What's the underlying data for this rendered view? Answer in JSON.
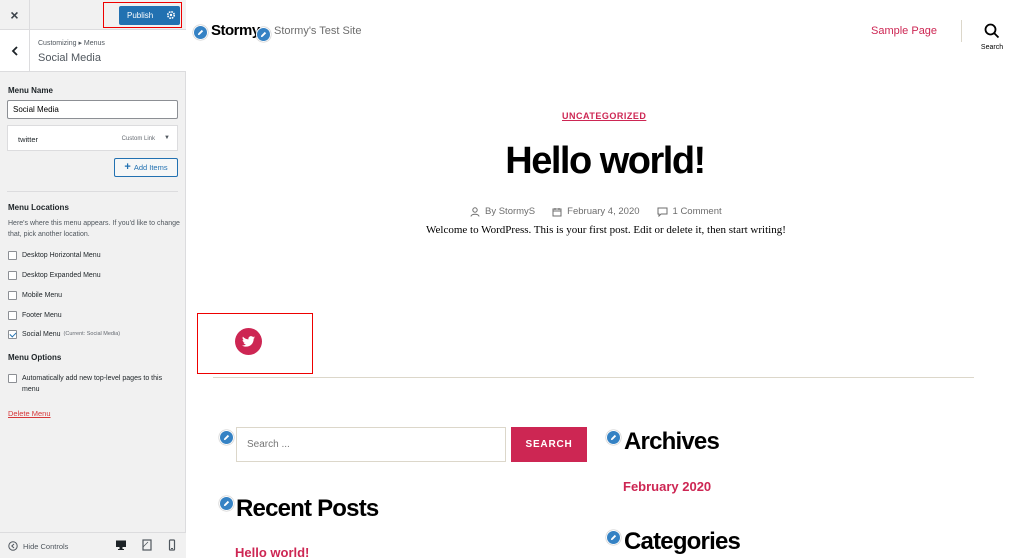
{
  "customizer": {
    "close_label": "×",
    "publish_label": "Publish",
    "breadcrumb": "Customizing ▸ Menus",
    "section_title": "Social Media",
    "menu_name_label": "Menu Name",
    "menu_name_value": "Social Media",
    "menu_item": {
      "title": "twitter",
      "type": "Custom Link",
      "toggle": "▼"
    },
    "add_items_label": "Add Items",
    "menu_locations_title": "Menu Locations",
    "menu_locations_desc": "Here's where this menu appears. If you'd like to change that, pick another location.",
    "locations": [
      {
        "label": "Desktop Horizontal Menu",
        "note": "",
        "checked": false
      },
      {
        "label": "Desktop Expanded Menu",
        "note": "",
        "checked": false
      },
      {
        "label": "Mobile Menu",
        "note": "",
        "checked": false
      },
      {
        "label": "Footer Menu",
        "note": "",
        "checked": false
      },
      {
        "label": "Social Menu",
        "note": "(Current: Social Media)",
        "checked": true
      }
    ],
    "menu_options_title": "Menu Options",
    "auto_add_label": "Automatically add new top-level pages to this menu",
    "delete_label": "Delete Menu",
    "hide_controls_label": "Hide Controls",
    "accent": "#2271b1"
  },
  "site": {
    "title": "Stormy",
    "description": "Stormy's Test Site",
    "nav_item": "Sample Page",
    "search_label": "Search",
    "accent": "#cd2653"
  },
  "post": {
    "category": "UNCATEGORIZED",
    "title": "Hello world!",
    "author": "By StormyS",
    "date": "February 4, 2020",
    "comments": "1 Comment",
    "excerpt": "Welcome to WordPress. This is your first post. Edit or delete it, then start writing!"
  },
  "social": {
    "icon": "twitter-icon"
  },
  "widgets": {
    "search_placeholder": "Search ...",
    "search_button": "SEARCH",
    "archives_title": "Archives",
    "archives_link": "February 2020",
    "recent_title": "Recent Posts",
    "recent_link": "Hello world!",
    "categories_title": "Categories"
  }
}
